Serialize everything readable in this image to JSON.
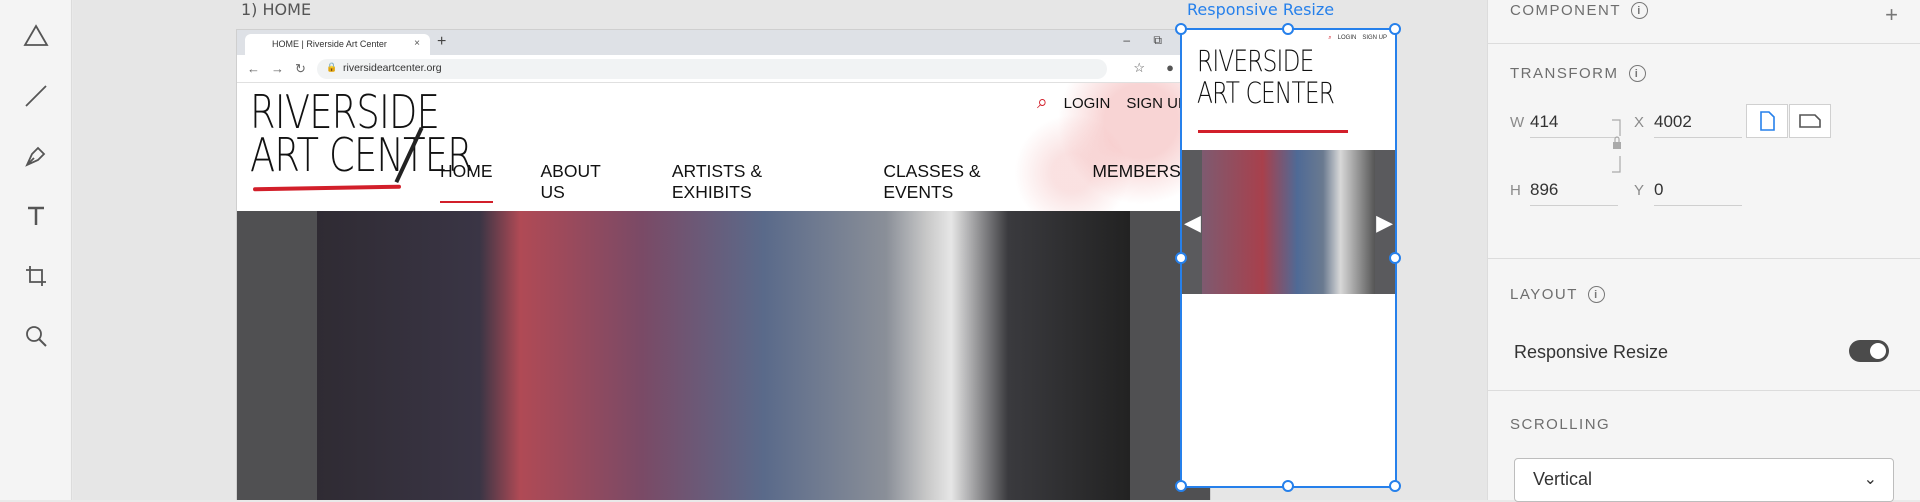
{
  "tools": [
    "triangle-tool",
    "line-tool",
    "pen-tool",
    "text-tool",
    "artboard-tool",
    "zoom-tool"
  ],
  "canvas": {
    "artboard1_label": "1) HOME",
    "artboard2_label": "Responsive Resize"
  },
  "browser": {
    "tab_title": "HOME | Riverside Art Center",
    "new_tab": "+",
    "url": "riversideartcenter.org"
  },
  "site": {
    "logo_line1": "RIVERSIDE",
    "logo_line2": "ART CENTER",
    "login": "LOGIN",
    "signup": "SIGN UP",
    "nav": [
      "HOME",
      "ABOUT US",
      "ARTISTS & EXHIBITS",
      "CLASSES & EVENTS",
      "MEMBERSHIP"
    ]
  },
  "mobile": {
    "logo_line1": "RIVERSIDE",
    "logo_line2": "ART CENTER",
    "login": "LOGIN",
    "signup": "SIGN UP"
  },
  "panel": {
    "component": "COMPONENT",
    "transform": "TRANSFORM",
    "w_label": "W",
    "w_value": "414",
    "x_label": "X",
    "x_value": "4002",
    "h_label": "H",
    "h_value": "896",
    "y_label": "Y",
    "y_value": "0",
    "layout": "LAYOUT",
    "responsive_resize": "Responsive Resize",
    "scrolling": "SCROLLING",
    "scroll_value": "Vertical"
  },
  "colors": {
    "accent": "#2680eb",
    "brand_red": "#d21f2a"
  }
}
